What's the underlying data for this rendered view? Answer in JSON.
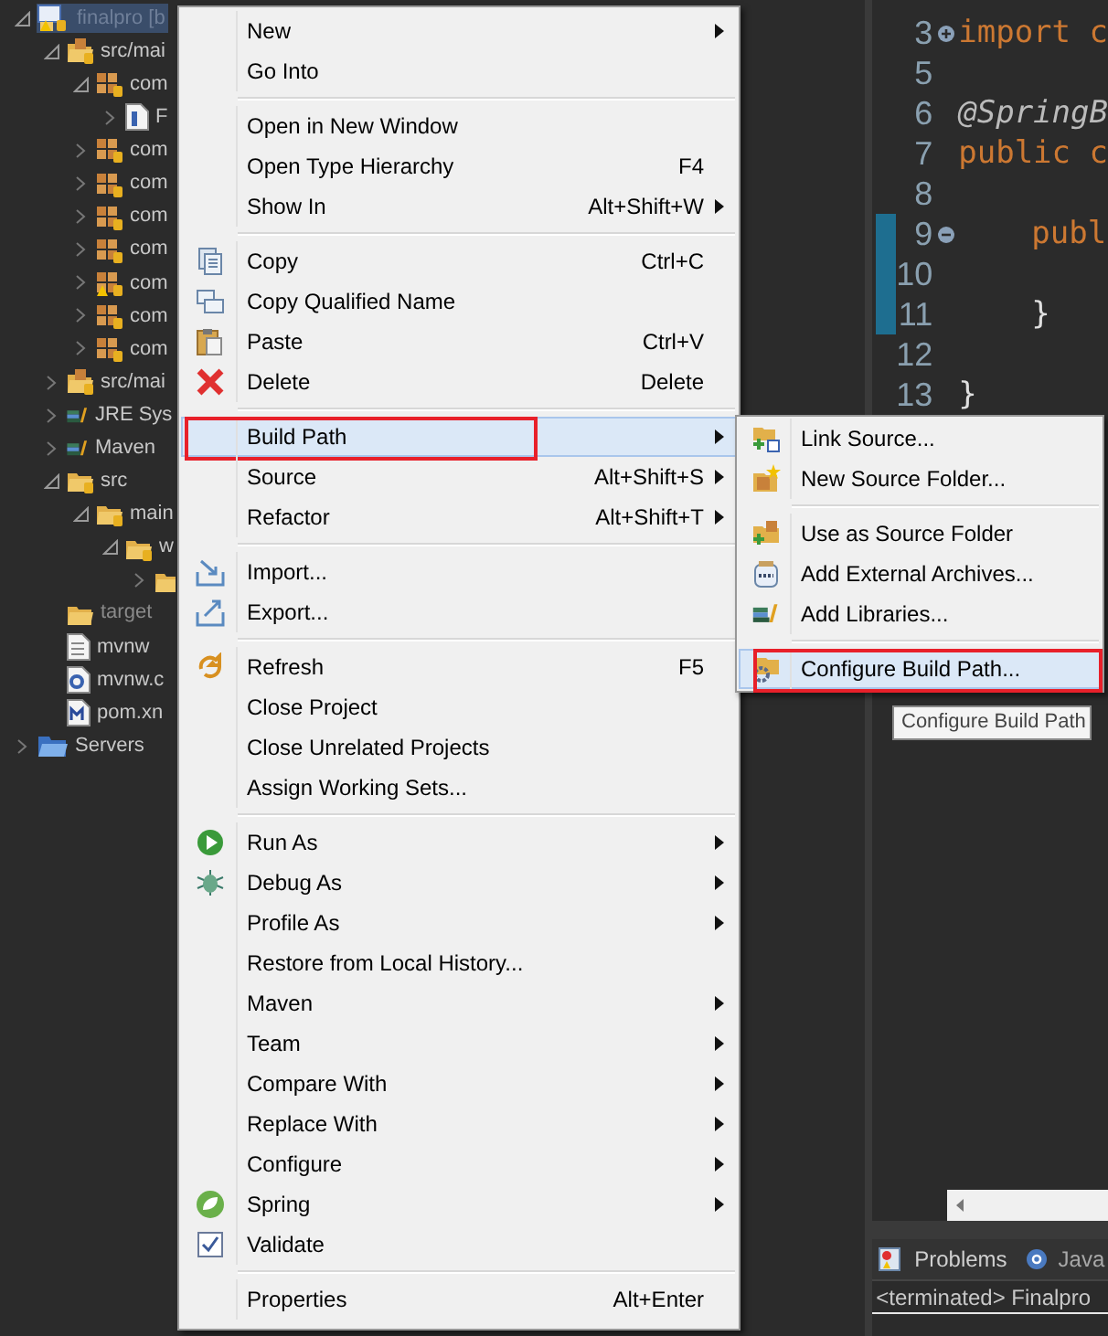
{
  "explorer": {
    "tree": [
      {
        "label": "finalpro [b",
        "kind": "project",
        "expanded": true,
        "selected": true,
        "children": [
          {
            "label": "src/mai",
            "kind": "source-folder",
            "expanded": true,
            "selected": false,
            "children": [
              {
                "label": "com",
                "kind": "package",
                "expanded": true,
                "selected": false,
                "children": [
                  {
                    "label": "F",
                    "kind": "java-file",
                    "expanded": false,
                    "selected": false
                  }
                ]
              },
              {
                "label": "com",
                "kind": "package",
                "expanded": false,
                "selected": false
              },
              {
                "label": "com",
                "kind": "package",
                "expanded": false,
                "selected": false
              },
              {
                "label": "com",
                "kind": "package",
                "expanded": false,
                "selected": false
              },
              {
                "label": "com",
                "kind": "package",
                "expanded": false,
                "selected": false
              },
              {
                "label": "com",
                "kind": "package-warning",
                "expanded": false,
                "selected": false
              },
              {
                "label": "com",
                "kind": "package",
                "expanded": false,
                "selected": false
              },
              {
                "label": "com",
                "kind": "package",
                "expanded": false,
                "selected": false
              }
            ]
          },
          {
            "label": "src/mai",
            "kind": "source-folder",
            "expanded": false,
            "selected": false
          },
          {
            "label": "JRE Sys",
            "kind": "library",
            "expanded": false,
            "selected": false
          },
          {
            "label": "Maven",
            "kind": "library",
            "expanded": false,
            "selected": false
          },
          {
            "label": "src",
            "kind": "folder",
            "expanded": true,
            "selected": false,
            "children": [
              {
                "label": "main",
                "kind": "folder",
                "expanded": true,
                "selected": false,
                "children": [
                  {
                    "label": "w",
                    "kind": "folder",
                    "expanded": true,
                    "selected": false,
                    "children": [
                      {
                        "kind": "folder-cut",
                        "expanded": false,
                        "selected": false
                      }
                    ]
                  }
                ]
              }
            ]
          },
          {
            "label": "target",
            "kind": "plain-folder",
            "selected": false
          },
          {
            "label": "mvnw",
            "kind": "file",
            "selected": false
          },
          {
            "label": "mvnw.c",
            "kind": "config-file",
            "selected": false
          },
          {
            "label": "pom.xn",
            "kind": "maven-file",
            "selected": false
          }
        ]
      },
      {
        "label": "Servers",
        "kind": "servers",
        "expanded": false,
        "selected": false
      }
    ]
  },
  "editor": {
    "lines": [
      {
        "number": "3",
        "text": "import c",
        "kind": "keyword",
        "collapsed": true,
        "changed": false
      },
      {
        "number": "5",
        "changed": false
      },
      {
        "number": "6",
        "text": "@SpringB",
        "kind": "annotation",
        "changed": false
      },
      {
        "number": "7",
        "text": "public c",
        "kind": "keyword",
        "changed": false
      },
      {
        "number": "8",
        "changed": false
      },
      {
        "number": "9",
        "text": "publ",
        "kind": "keyword-indented",
        "collapsed": false,
        "changed": true
      },
      {
        "number": "10",
        "changed": true
      },
      {
        "number": "11",
        "text": "}",
        "kind": "plain-indented",
        "changed": true
      },
      {
        "number": "12",
        "changed": false
      },
      {
        "number": "13",
        "text": "}",
        "kind": "plain",
        "changed": false
      }
    ]
  },
  "bottom_panel": {
    "tabs": [
      {
        "label": "Problems",
        "kind": "problems",
        "selected": true
      },
      {
        "label": "Java",
        "kind": "javadoc",
        "selected": false
      }
    ],
    "console_line": "<terminated> Finalpro"
  },
  "context_menu": {
    "groups": [
      [
        {
          "label": "New",
          "submenu": true,
          "selected": false
        },
        {
          "label": "Go Into",
          "submenu": false,
          "selected": false
        }
      ],
      [
        {
          "label": "Open in New Window",
          "submenu": false,
          "selected": false
        },
        {
          "label": "Open Type Hierarchy",
          "shortcut": "F4",
          "submenu": false,
          "selected": false
        },
        {
          "label": "Show In",
          "shortcut": "Alt+Shift+W",
          "submenu": true,
          "selected": false
        }
      ],
      [
        {
          "label": "Copy",
          "shortcut": "Ctrl+C",
          "submenu": false,
          "selected": false
        },
        {
          "label": "Copy Qualified Name",
          "submenu": false,
          "selected": false
        },
        {
          "label": "Paste",
          "shortcut": "Ctrl+V",
          "submenu": false,
          "selected": false
        },
        {
          "label": "Delete",
          "shortcut": "Delete",
          "submenu": false,
          "selected": false
        }
      ],
      [
        {
          "label": "Build Path",
          "submenu": true,
          "selected": true,
          "annotated": true
        },
        {
          "label": "Source",
          "shortcut": "Alt+Shift+S",
          "submenu": true,
          "selected": false
        },
        {
          "label": "Refactor",
          "shortcut": "Alt+Shift+T",
          "submenu": true,
          "selected": false
        }
      ],
      [
        {
          "label": "Import...",
          "submenu": false,
          "selected": false
        },
        {
          "label": "Export...",
          "submenu": false,
          "selected": false
        }
      ],
      [
        {
          "label": "Refresh",
          "shortcut": "F5",
          "submenu": false,
          "selected": false
        },
        {
          "label": "Close Project",
          "submenu": false,
          "selected": false
        },
        {
          "label": "Close Unrelated Projects",
          "submenu": false,
          "selected": false
        },
        {
          "label": "Assign Working Sets...",
          "submenu": false,
          "selected": false
        }
      ],
      [
        {
          "label": "Run As",
          "submenu": true,
          "selected": false
        },
        {
          "label": "Debug As",
          "submenu": true,
          "selected": false
        },
        {
          "label": "Profile As",
          "submenu": true,
          "selected": false
        },
        {
          "label": "Restore from Local History...",
          "submenu": false,
          "selected": false
        },
        {
          "label": "Maven",
          "submenu": true,
          "selected": false
        },
        {
          "label": "Team",
          "submenu": true,
          "selected": false
        },
        {
          "label": "Compare With",
          "submenu": true,
          "selected": false
        },
        {
          "label": "Replace With",
          "submenu": true,
          "selected": false
        },
        {
          "label": "Configure",
          "submenu": true,
          "selected": false
        },
        {
          "label": "Spring",
          "submenu": true,
          "selected": false
        },
        {
          "label": "Validate",
          "submenu": false,
          "selected": false
        }
      ],
      [
        {
          "label": "Properties",
          "shortcut": "Alt+Enter",
          "submenu": false,
          "selected": false
        }
      ]
    ]
  },
  "submenu": {
    "groups": [
      [
        {
          "label": "Link Source...",
          "selected": false
        },
        {
          "label": "New Source Folder...",
          "selected": false
        }
      ],
      [
        {
          "label": "Use as Source Folder",
          "selected": false
        },
        {
          "label": "Add External Archives...",
          "selected": false
        },
        {
          "label": "Add Libraries...",
          "selected": false
        }
      ],
      [
        {
          "label": "Configure Build Path...",
          "selected": true,
          "annotated": true
        }
      ]
    ]
  },
  "tooltip": "Configure Build Path"
}
